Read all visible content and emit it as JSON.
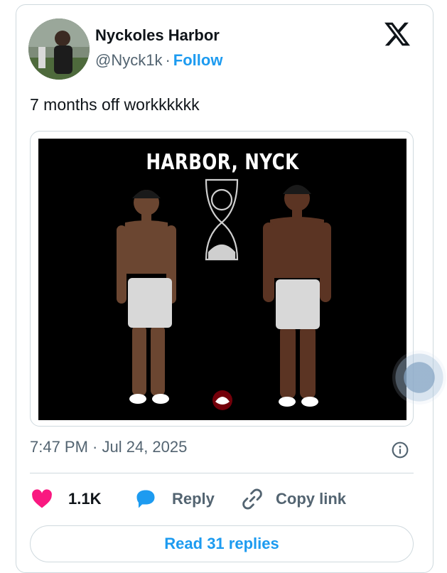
{
  "author": {
    "name": "Nyckoles Harbor",
    "handle": "@Nyck1k",
    "separator": "·",
    "follow_label": "Follow"
  },
  "tweet": {
    "text": "7 months off workkkkkk",
    "timestamp": "7:47 PM · Jul 24, 2025"
  },
  "media": {
    "title": "HARBOR, NYCK",
    "description_icon": "hourglass-icon"
  },
  "actions": {
    "like_count": "1.1K",
    "reply_label": "Reply",
    "copy_label": "Copy link"
  },
  "read_replies_label": "Read 31 replies",
  "colors": {
    "accent": "#1d9bf0",
    "like": "#f91880",
    "text": "#0f1419",
    "muted": "#536471",
    "border": "#cfd9de"
  }
}
